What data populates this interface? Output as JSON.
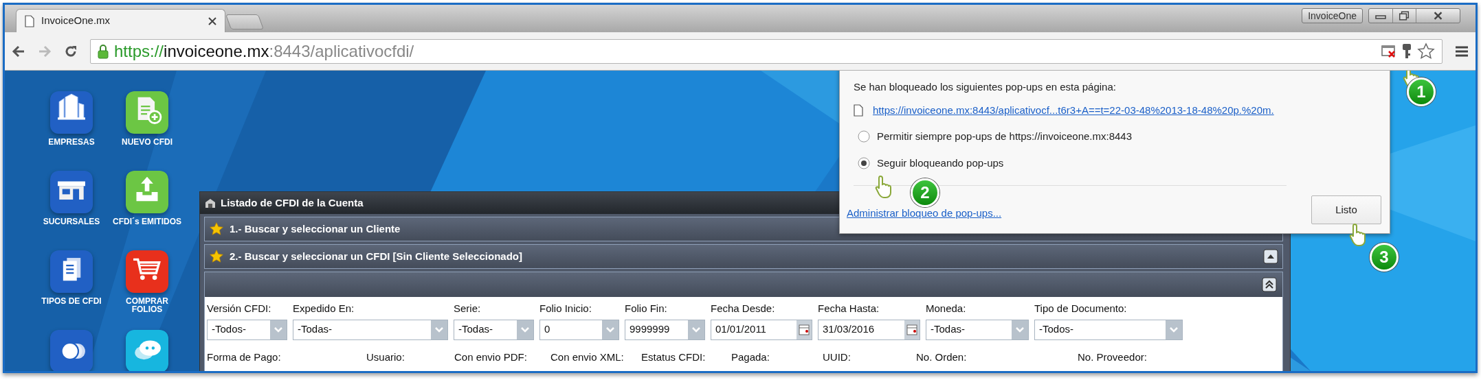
{
  "browser": {
    "tab": {
      "title": "InvoiceOne.mx"
    },
    "profile_button": "InvoiceOne",
    "url": {
      "scheme": "https://",
      "host": "invoiceone.mx",
      "rest": ":8443/aplicativocfdi/"
    }
  },
  "apps": [
    {
      "label": "EMPRESAS",
      "color": "#2160c4"
    },
    {
      "label": "NUEVO CFDI",
      "color": "#6cc644"
    },
    {
      "label": "SUCURSALES",
      "color": "#2160c4"
    },
    {
      "label": "CFDI´s EMITIDOS",
      "color": "#6cc644"
    },
    {
      "label": "TIPOS DE CFDI",
      "color": "#2160c4"
    },
    {
      "label": "COMPRAR FOLIOS",
      "color": "#e8301c"
    },
    {
      "color": "#2160c4"
    },
    {
      "color": "#17b6df"
    }
  ],
  "window": {
    "title": "Listado de CFDI de la Cuenta",
    "sections": [
      {
        "title": "1.- Buscar y seleccionar un Cliente"
      },
      {
        "title": "2.- Buscar y seleccionar un CFDI [Sin Cliente Seleccionado]"
      }
    ],
    "filters": [
      {
        "label": "Versión CFDI:",
        "value": "-Todos-",
        "kind": "select"
      },
      {
        "label": "Expedido En:",
        "value": "-Todas-",
        "kind": "select"
      },
      {
        "label": "Serie:",
        "value": "-Todas-",
        "kind": "select"
      },
      {
        "label": "Folio Inicio:",
        "value": "0",
        "kind": "select"
      },
      {
        "label": "Folio Fin:",
        "value": "9999999",
        "kind": "select"
      },
      {
        "label": "Fecha Desde:",
        "value": "01/01/2011",
        "kind": "date"
      },
      {
        "label": "Fecha Hasta:",
        "value": "31/03/2016",
        "kind": "date"
      },
      {
        "label": "Moneda:",
        "value": "-Todas-",
        "kind": "select"
      },
      {
        "label": "Tipo de Documento:",
        "value": "-Todos-",
        "kind": "select"
      }
    ],
    "more_labels": [
      "Forma de Pago:",
      "Usuario:",
      "Con envio PDF:",
      "Con envio XML:",
      "Estatus CFDI:",
      "Pagada:",
      "UUID:",
      "No. Orden:",
      "No. Proveedor:"
    ]
  },
  "popup": {
    "heading": "Se han bloqueado los siguientes pop-ups en esta página:",
    "link": "https://invoiceone.mx:8443/aplicativocf...t6r3+A==t=22-03-48%2013-18-48%20p.%20m.",
    "options": [
      {
        "label": "Permitir siempre pop-ups de https://invoiceone.mx:8443",
        "selected": false
      },
      {
        "label": "Seguir bloqueando pop-ups",
        "selected": true
      }
    ],
    "manage_link": "Administrar bloqueo de pop-ups...",
    "done_button": "Listo"
  },
  "annotations": [
    {
      "number": "1"
    },
    {
      "number": "2"
    },
    {
      "number": "3"
    }
  ]
}
